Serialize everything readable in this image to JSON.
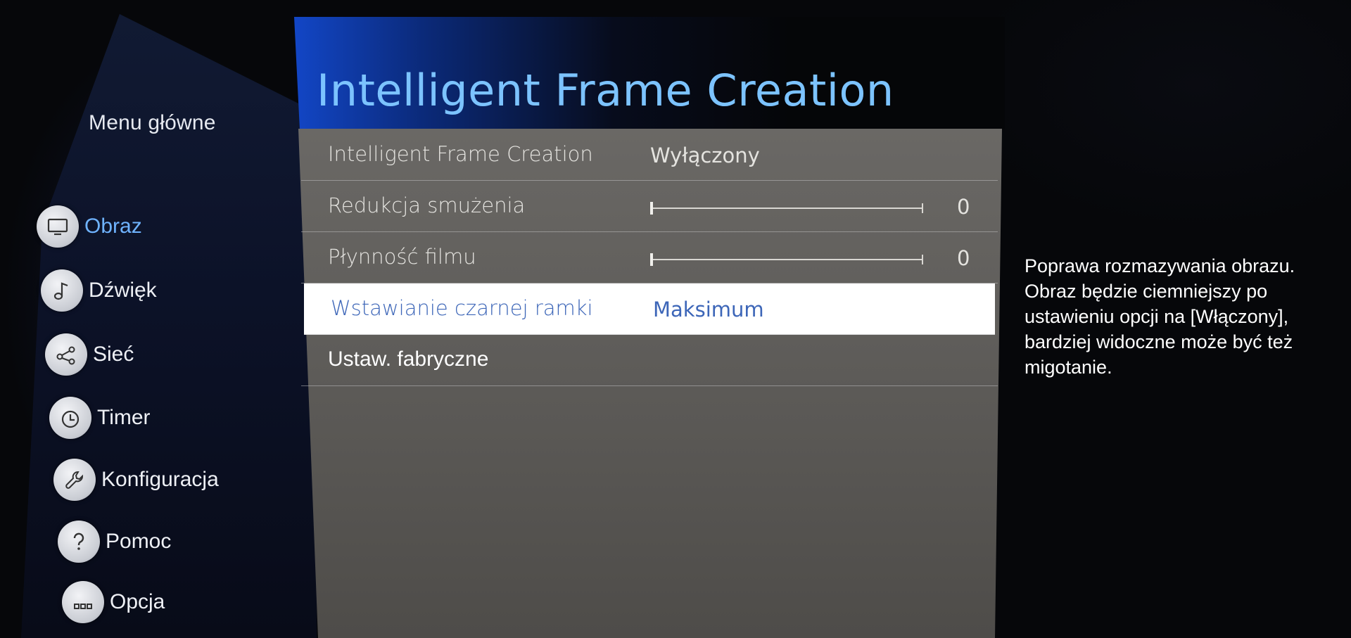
{
  "sidebar": {
    "title": "Menu główne",
    "items": [
      {
        "label": "Obraz",
        "icon": "tv-icon",
        "active": true
      },
      {
        "label": "Dźwięk",
        "icon": "music-note-icon",
        "active": false
      },
      {
        "label": "Sieć",
        "icon": "share-network-icon",
        "active": false
      },
      {
        "label": "Timer",
        "icon": "clock-icon",
        "active": false
      },
      {
        "label": "Konfiguracja",
        "icon": "wrench-icon",
        "active": false
      },
      {
        "label": "Pomoc",
        "icon": "question-icon",
        "active": false
      },
      {
        "label": "Opcja",
        "icon": "dots-icon",
        "active": false
      }
    ]
  },
  "panel": {
    "title": "Intelligent Frame Creation",
    "rows": [
      {
        "label": "Intelligent Frame Creation",
        "value": "Wyłączony"
      },
      {
        "label": "Redukcja smużenia",
        "value": "0",
        "level": 0
      },
      {
        "label": "Płynność filmu",
        "value": "0",
        "level": 0
      },
      {
        "label": "Wstawianie czarnej ramki",
        "value": "Maksimum",
        "selected": true
      },
      {
        "label": "Ustaw. fabryczne"
      }
    ]
  },
  "help": {
    "text": "Poprawa rozmazywania obrazu. Obraz będzie ciemniejszy po ustawieniu opcji na [Włączony], bardziej widoczne może być też migotanie."
  },
  "colors": {
    "accent": "#6fb3ff",
    "title": "#7cc3ff",
    "selected_text": "#3d66b8",
    "panel_bg": "#5e5c59"
  }
}
